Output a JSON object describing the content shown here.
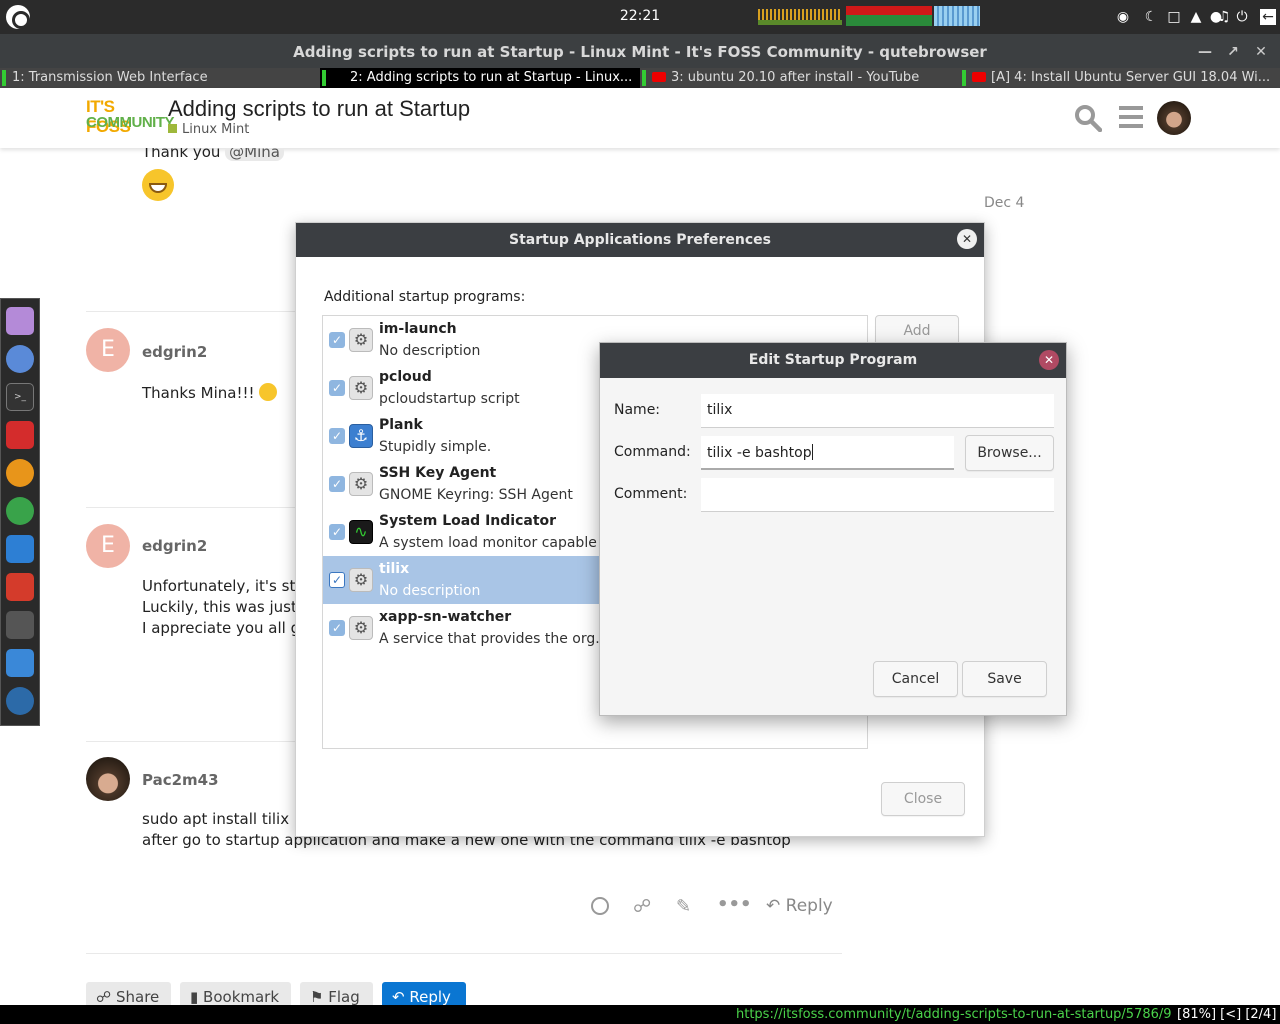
{
  "panel": {
    "clock": "22:21"
  },
  "window": {
    "title": "Adding scripts to run at Startup - Linux Mint - It's FOSS Community - qutebrowser"
  },
  "tabs": [
    {
      "label": "1: Transmission Web Interface"
    },
    {
      "label": "2: Adding scripts to run at Startup - Linux..."
    },
    {
      "label": "3: ubuntu 20.10 after install - YouTube"
    },
    {
      "label": "[A] 4: Install Ubuntu Server GUI 18.04 Wi..."
    }
  ],
  "site": {
    "logo_line1": "IT'S FOSS",
    "logo_line2": "COMMUNITY",
    "topic_title": "Adding scripts to run at Startup",
    "category": "Linux Mint"
  },
  "posts": {
    "prev_text": "Thank you",
    "prev_mention": "@Mina",
    "date": "Dec 4",
    "p1": {
      "avatar": "E",
      "user": "edgrin2",
      "text": "Thanks Mina!!!"
    },
    "p2": {
      "avatar": "E",
      "user": "edgrin2",
      "lines": [
        "Unfortunately, it's still n",
        "Luckily, this was just cu",
        "I appreciate you all givi"
      ]
    },
    "p3": {
      "user": "Pac2m43",
      "lines": [
        "sudo apt install tilix",
        "after go to startup application and make a new one with the command tilix -e bashtop"
      ],
      "reply": "Reply"
    }
  },
  "actions": {
    "share": "Share",
    "bookmark": "Bookmark",
    "flag": "Flag",
    "reply": "Reply"
  },
  "startup_dialog": {
    "title": "Startup Applications Preferences",
    "heading": "Additional startup programs:",
    "add": "Add",
    "close": "Close",
    "programs": [
      {
        "name": "im-launch",
        "desc": "No description",
        "icon": "gear-icon"
      },
      {
        "name": "pcloud",
        "desc": "pcloudstartup script",
        "icon": "gear-icon"
      },
      {
        "name": "Plank",
        "desc": "Stupidly simple.",
        "icon": "anchor-icon"
      },
      {
        "name": "SSH Key Agent",
        "desc": "GNOME Keyring: SSH Agent",
        "icon": "gear-icon"
      },
      {
        "name": "System Load Indicator",
        "desc": "A system load monitor capable c",
        "icon": "system-monitor-icon"
      },
      {
        "name": "tilix",
        "desc": "No description",
        "icon": "gear-icon"
      },
      {
        "name": "xapp-sn-watcher",
        "desc": "A service that provides the org.k",
        "icon": "gear-icon"
      }
    ]
  },
  "edit_dialog": {
    "title": "Edit Startup Program",
    "name_label": "Name:",
    "name_value": "tilix",
    "command_label": "Command:",
    "command_value": "tilix -e bashtop",
    "comment_label": "Comment:",
    "comment_value": "",
    "browse": "Browse...",
    "cancel": "Cancel",
    "save": "Save"
  },
  "statusbar": {
    "url": "https://itsfoss.community/t/adding-scripts-to-run-at-startup/5786/9",
    "info": "[81%] [<] [2/4]"
  },
  "colors": {
    "accent": "#0a76d2",
    "selection": "#a9c5e6",
    "logo_orange": "#f2a900",
    "logo_green": "#61b04a"
  }
}
